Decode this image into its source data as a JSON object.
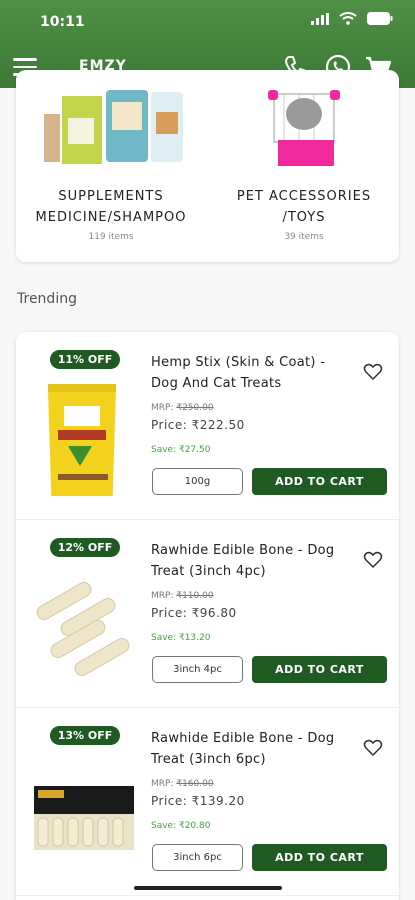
{
  "status_bar": {
    "time": "10:11"
  },
  "header": {
    "title": "EMZY",
    "icons": [
      "menu-icon",
      "phone-icon",
      "whatsapp-icon",
      "cart-icon"
    ],
    "color": "#3c7a36"
  },
  "categories": [
    {
      "name_line1": "SUPPLEMENTS",
      "name_line2": "MEDICINE/SHAMPOO",
      "count": "119 items"
    },
    {
      "name_line1": "PET ACCESSORIES",
      "name_line2": "/TOYS",
      "count": "39 items"
    }
  ],
  "section": {
    "trending_label": "Trending"
  },
  "products": [
    {
      "discount": "11% OFF",
      "name": "Hemp Stix (Skin & Coat) - Dog And Cat Treats",
      "mrp_label": "MRP: ",
      "mrp": "₹250.00",
      "price": "Price: ₹222.50",
      "save": "Save: ₹27.50",
      "variant": "100g",
      "cta": "ADD TO CART"
    },
    {
      "discount": "12% OFF",
      "name": "Rawhide Edible Bone - Dog Treat (3inch 4pc)",
      "mrp_label": "MRP: ",
      "mrp": "₹110.00",
      "price": "Price: ₹96.80",
      "save": "Save: ₹13.20",
      "variant": "3inch 4pc",
      "cta": "ADD TO CART"
    },
    {
      "discount": "13% OFF",
      "name": "Rawhide Edible Bone - Dog Treat (3inch 6pc)",
      "mrp_label": "MRP: ",
      "mrp": "₹160.00",
      "price": "Price: ₹139.20",
      "save": "Save: ₹20.80",
      "variant": "3inch 6pc",
      "cta": "ADD TO CART"
    }
  ],
  "colors": {
    "brand": "#1e5a22",
    "save": "#3ea63a"
  }
}
